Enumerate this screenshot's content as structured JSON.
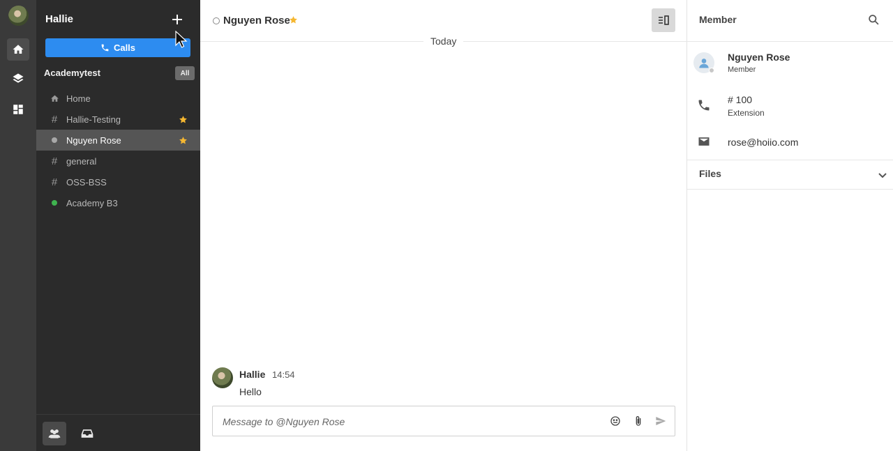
{
  "workspace": {
    "user_name": "Hallie",
    "calls_label": "Calls",
    "team_name": "Academytest",
    "filter_label": "All"
  },
  "channels": [
    {
      "label": "Home",
      "icon": "home-icon"
    },
    {
      "label": "Hallie-Testing",
      "icon": "hash-icon",
      "starred": true
    },
    {
      "label": "Nguyen Rose",
      "icon": "status-dot",
      "starred": true,
      "selected": true
    },
    {
      "label": "general",
      "icon": "hash-icon"
    },
    {
      "label": "OSS-BSS",
      "icon": "hash-icon"
    },
    {
      "label": "Academy B3",
      "icon": "online-dot"
    }
  ],
  "conversation": {
    "title": "Nguyen Rose",
    "date_separator": "Today",
    "messages": [
      {
        "author": "Hallie",
        "time": "14:54",
        "text": "Hello"
      }
    ],
    "composer_placeholder": "Message to @Nguyen Rose"
  },
  "member_panel": {
    "title": "Member",
    "name": "Nguyen Rose",
    "role": "Member",
    "extension_value": "# 100",
    "extension_label": "Extension",
    "email": "rose@hoiio.com",
    "files_label": "Files"
  },
  "colors": {
    "accent": "#2d8cf0",
    "star": "#f5b731",
    "online": "#3fb34f",
    "sidebar_bg": "#2b2b2b",
    "rail_bg": "#3a3a3a"
  }
}
